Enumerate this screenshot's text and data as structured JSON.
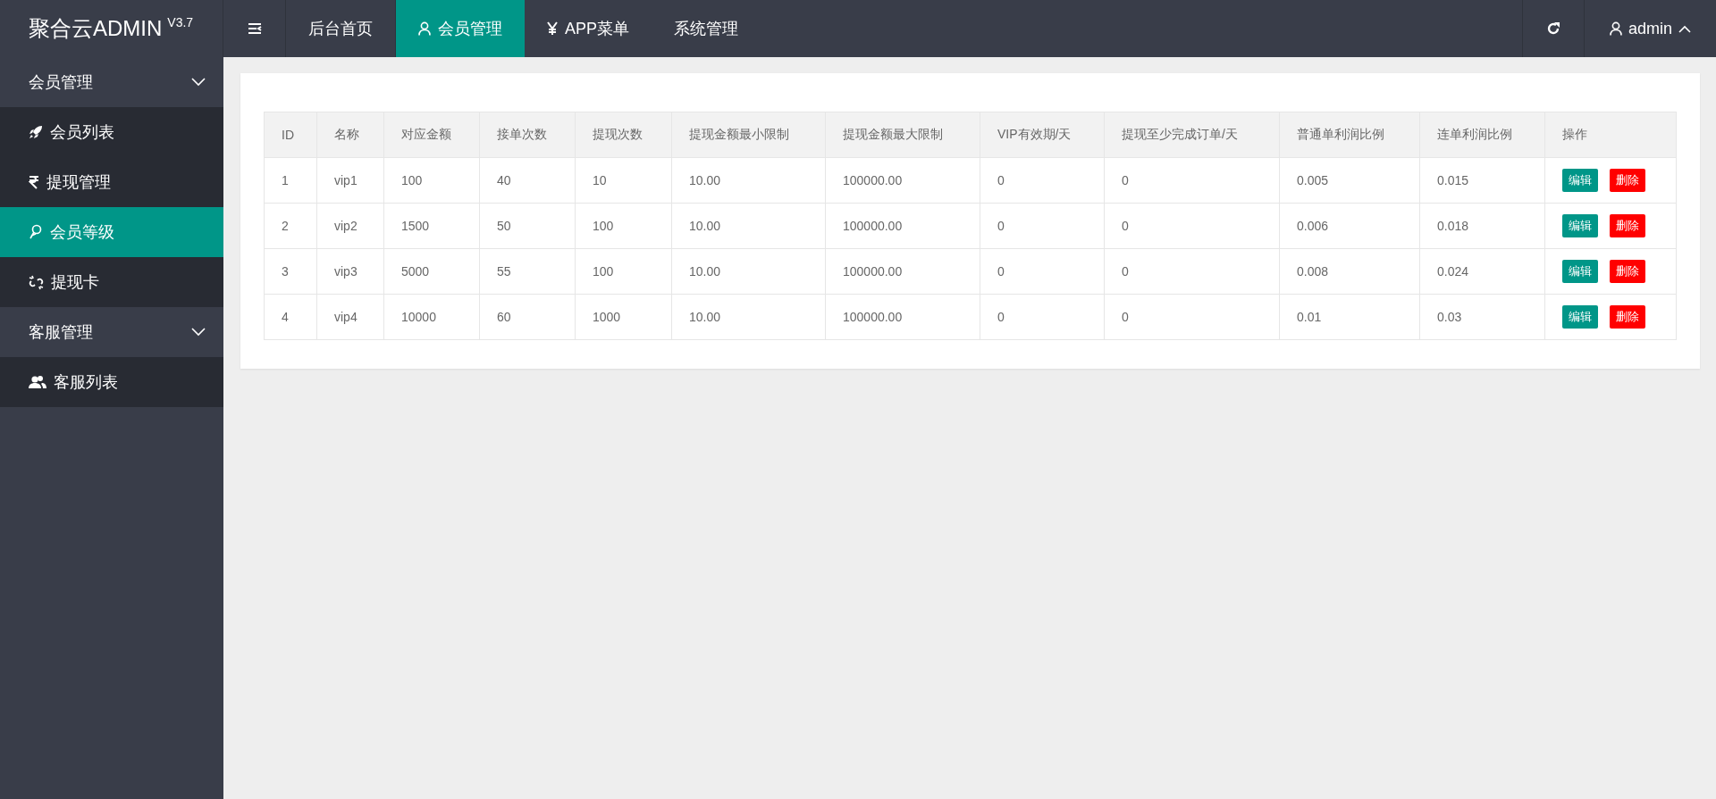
{
  "logo": {
    "name": "聚合云ADMIN",
    "version": "V3.7"
  },
  "nav": [
    {
      "label": "后台首页",
      "kind": "plain",
      "selected": false
    },
    {
      "label": "会员管理",
      "kind": "user",
      "selected": true
    },
    {
      "label": "APP菜单",
      "kind": "yen",
      "selected": false
    },
    {
      "label": "系统管理",
      "kind": "plain",
      "selected": false
    }
  ],
  "user": {
    "name": "admin",
    "expanded": true
  },
  "sidebar": {
    "groups": [
      {
        "label": "会员管理",
        "expanded": true,
        "items": [
          {
            "label": "会员列表",
            "kind": "rocket",
            "selected": false
          },
          {
            "label": "提现管理",
            "kind": "rupee",
            "selected": false
          },
          {
            "label": "会员等级",
            "kind": "level",
            "selected": true
          },
          {
            "label": "提现卡",
            "kind": "unlink",
            "selected": false
          }
        ]
      },
      {
        "label": "客服管理",
        "expanded": true,
        "items": [
          {
            "label": "客服列表",
            "kind": "users",
            "selected": false
          }
        ]
      }
    ]
  },
  "table": {
    "columns": [
      "ID",
      "名称",
      "对应金额",
      "接单次数",
      "提现次数",
      "提现金额最小限制",
      "提现金额最大限制",
      "VIP有效期/天",
      "提现至少完成订单/天",
      "普通单利润比例",
      "连单利润比例",
      "操作"
    ],
    "rows": [
      {
        "cells": [
          "1",
          "vip1",
          "100",
          "40",
          "10",
          "10.00",
          "100000.00",
          "0",
          "0",
          "0.005",
          "0.015"
        ],
        "actions": [
          {
            "label": "编辑",
            "kind": "edit"
          },
          {
            "label": "删除",
            "kind": "delete"
          }
        ]
      },
      {
        "cells": [
          "2",
          "vip2",
          "1500",
          "50",
          "100",
          "10.00",
          "100000.00",
          "0",
          "0",
          "0.006",
          "0.018"
        ],
        "actions": [
          {
            "label": "编辑",
            "kind": "edit"
          },
          {
            "label": "删除",
            "kind": "delete"
          }
        ]
      },
      {
        "cells": [
          "3",
          "vip3",
          "5000",
          "55",
          "100",
          "10.00",
          "100000.00",
          "0",
          "0",
          "0.008",
          "0.024"
        ],
        "actions": [
          {
            "label": "编辑",
            "kind": "edit"
          },
          {
            "label": "删除",
            "kind": "delete"
          }
        ]
      },
      {
        "cells": [
          "4",
          "vip4",
          "10000",
          "60",
          "1000",
          "10.00",
          "100000.00",
          "0",
          "0",
          "0.01",
          "0.03"
        ],
        "actions": [
          {
            "label": "编辑",
            "kind": "edit"
          },
          {
            "label": "删除",
            "kind": "delete"
          }
        ]
      }
    ]
  }
}
